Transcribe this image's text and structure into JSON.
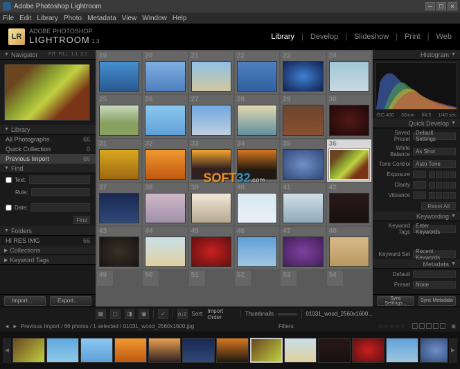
{
  "titlebar": {
    "title": "Adobe Photoshop Lightroom"
  },
  "menubar": [
    "File",
    "Edit",
    "Library",
    "Photo",
    "Metadata",
    "View",
    "Window",
    "Help"
  ],
  "logo": {
    "badge": "LR",
    "line1": "ADOBE PHOTOSHOP",
    "line2": "LIGHTROOM",
    "ver": "1.3"
  },
  "modules": [
    "Library",
    "Develop",
    "Slideshow",
    "Print",
    "Web"
  ],
  "nav": {
    "title": "Navigator",
    "info": [
      "FIT",
      "FILL",
      "1:1",
      "2:1"
    ]
  },
  "library": {
    "title": "Library",
    "items": [
      {
        "label": "All Photographs",
        "count": "66"
      },
      {
        "label": "Quick Collection",
        "count": "0"
      },
      {
        "label": "Previous Import",
        "count": "66"
      }
    ]
  },
  "find": {
    "title": "Find",
    "text_label": "Text:",
    "rule_label": "Rule:",
    "date_label": "Date:",
    "find_btn": "Find"
  },
  "folders": {
    "title": "Folders",
    "item": "HI RES IMG",
    "count": "66"
  },
  "collections": {
    "title": "Collections"
  },
  "keywordtags_left": {
    "title": "Keyword Tags"
  },
  "left_buttons": {
    "import": "Import...",
    "export": "Export..."
  },
  "histogram": {
    "title": "Histogram",
    "info": [
      "ISO 400",
      "30mm",
      "f/4.5",
      "1/40 sec"
    ]
  },
  "quickdev": {
    "title": "Quick Develop",
    "rows": [
      {
        "label": "Saved Preset",
        "value": "Default Settings"
      },
      {
        "label": "White Balance",
        "value": "As Shot"
      },
      {
        "label": "Tone Control",
        "value": "Auto Tone"
      },
      {
        "label": "Exposure",
        "value": ""
      },
      {
        "label": "Clarity",
        "value": ""
      },
      {
        "label": "Vibrance",
        "value": ""
      }
    ],
    "reset": "Reset All"
  },
  "keywording": {
    "title": "Keywording",
    "tags_label": "Keyword Tags",
    "tags_value": "Enter Keywords",
    "set_label": "Keyword Set",
    "set_value": "Recent Keywords"
  },
  "metadata": {
    "title": "Metadata",
    "default_label": "Default",
    "preset_label": "Preset",
    "preset_value": "None"
  },
  "right_buttons": {
    "sync_settings": "Sync Settings...",
    "sync_metadata": "Sync Metadata"
  },
  "grid": {
    "rows": [
      [
        {
          "n": "19",
          "c": "linear-gradient(#4590d0,#2a5a90)"
        },
        {
          "n": "20",
          "c": "linear-gradient(#80b0e0,#5080c0)"
        },
        {
          "n": "21",
          "c": "linear-gradient(#90c0e8,#d0c8a0)"
        },
        {
          "n": "22",
          "c": "linear-gradient(#5080c0,#3060a0)"
        },
        {
          "n": "23",
          "c": "radial-gradient(#4080d0,#102050)"
        },
        {
          "n": "24",
          "c": "linear-gradient(#a0c8d8,#c8d8e0)"
        }
      ],
      [
        {
          "n": "25",
          "c": "linear-gradient(#c8d8c0,#88a060 60%)"
        },
        {
          "n": "26",
          "c": "linear-gradient(#8ac8f0,#60a0d8)"
        },
        {
          "n": "27",
          "c": "linear-gradient(#70a8e0,#c0d0e0)"
        },
        {
          "n": "28",
          "c": "linear-gradient(#e0d8b0,#6090a0)"
        },
        {
          "n": "29",
          "c": "linear-gradient(#6a4530,#8a5030)"
        },
        {
          "n": "30",
          "c": "radial-gradient(#501818,#200808)"
        }
      ],
      [
        {
          "n": "31",
          "c": "linear-gradient(#d8a820,#a06810)"
        },
        {
          "n": "32",
          "c": "linear-gradient(#f09830,#c05810)"
        },
        {
          "n": "33",
          "c": "linear-gradient(#f8a830,#302020 65%)"
        },
        {
          "n": "34",
          "c": "linear-gradient(#d87820,#201810 70%)"
        },
        {
          "n": "35",
          "c": "radial-gradient(#7090c8,#304878)"
        },
        {
          "n": "36",
          "c": "linear-gradient(135deg,#6a4520 20%,#8aa030 40%,#c0d040 55%,#7a3518 75%)",
          "sel": true
        }
      ],
      [
        {
          "n": "37",
          "c": "linear-gradient(#182850,#304878)"
        },
        {
          "n": "38",
          "c": "linear-gradient(#d0b8c8,#a090a8)"
        },
        {
          "n": "39",
          "c": "linear-gradient(#f0e8d8,#b8a890)"
        },
        {
          "n": "40",
          "c": "linear-gradient(#d8e8f0,#e8f0f8)"
        },
        {
          "n": "41",
          "c": "linear-gradient(#d0e0e8,#90a8b8)"
        },
        {
          "n": "42",
          "c": "linear-gradient(#281818,#181010)"
        }
      ],
      [
        {
          "n": "43",
          "c": "radial-gradient(#383028,#181410)"
        },
        {
          "n": "44",
          "c": "linear-gradient(#c8e0e8,#e0d0a0)"
        },
        {
          "n": "45",
          "c": "radial-gradient(#c82020,#601010)"
        },
        {
          "n": "46",
          "c": "linear-gradient(#60a0d8,#a0c8e0)"
        },
        {
          "n": "47",
          "c": "radial-gradient(#8040a0,#402058)"
        },
        {
          "n": "48",
          "c": "linear-gradient(#d8b888,#b89860)"
        }
      ]
    ],
    "partial": [
      "49",
      "50",
      "51",
      "52",
      "53",
      "54"
    ]
  },
  "toolbar": {
    "sort_label": "Sort:",
    "sort_value": "Import Order",
    "thumb_label": "Thumbnails",
    "filename": "01031_wood_2560x1600..."
  },
  "statusbar": {
    "text": "Previous Import / 66 photos / 1 selected / 01031_wood_2560x1600.jpg",
    "filters": "Filters"
  },
  "filmstrip_colors": [
    "linear-gradient(135deg,#6a4520,#c0d040)",
    "linear-gradient(#60a8e0,#90c8e8)",
    "linear-gradient(#8ac8f0,#60a0d8)",
    "linear-gradient(#f09830,#c05810)",
    "linear-gradient(#e8a050,#302020)",
    "linear-gradient(#182850,#304878)",
    "linear-gradient(#d87820,#201810)",
    "linear-gradient(135deg,#6a4520,#c0d040)",
    "linear-gradient(#c8e0e8,#e0d0a0)",
    "linear-gradient(#281818,#181010)",
    "radial-gradient(#c82020,#601010)",
    "linear-gradient(#60a0d8,#a0c8e0)",
    "radial-gradient(#7090c8,#304878)"
  ]
}
